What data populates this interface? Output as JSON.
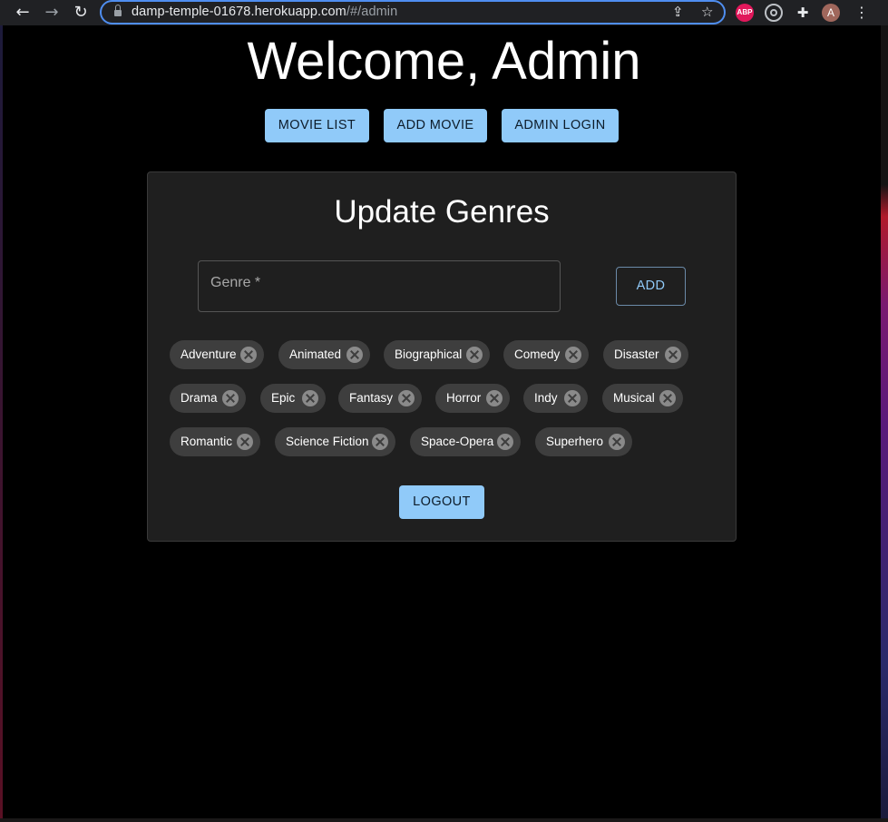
{
  "browser": {
    "url_host": "damp-temple-01678.herokuapp.com",
    "url_path": "/#/admin",
    "extension_abp_label": "ABP",
    "avatar_initial": "A"
  },
  "header": {
    "title": "Welcome, Admin",
    "nav": [
      {
        "label": "MOVIE LIST"
      },
      {
        "label": "ADD MOVIE"
      },
      {
        "label": "ADMIN LOGIN"
      }
    ]
  },
  "panel": {
    "title": "Update Genres",
    "genre_field_label": "Genre *",
    "add_label": "ADD",
    "genres": [
      "Adventure",
      "Animated",
      "Biographical",
      "Comedy",
      "Disaster",
      "Drama",
      "Epic",
      "Fantasy",
      "Horror",
      "Indy",
      "Musical",
      "Romantic",
      "Science Fiction",
      "Space-Opera",
      "Superhero"
    ],
    "logout_label": "LOGOUT"
  },
  "colors": {
    "accent": "#90caf9",
    "background": "#000000",
    "panel": "#1f1f1f",
    "chip": "#3e3e3e"
  }
}
